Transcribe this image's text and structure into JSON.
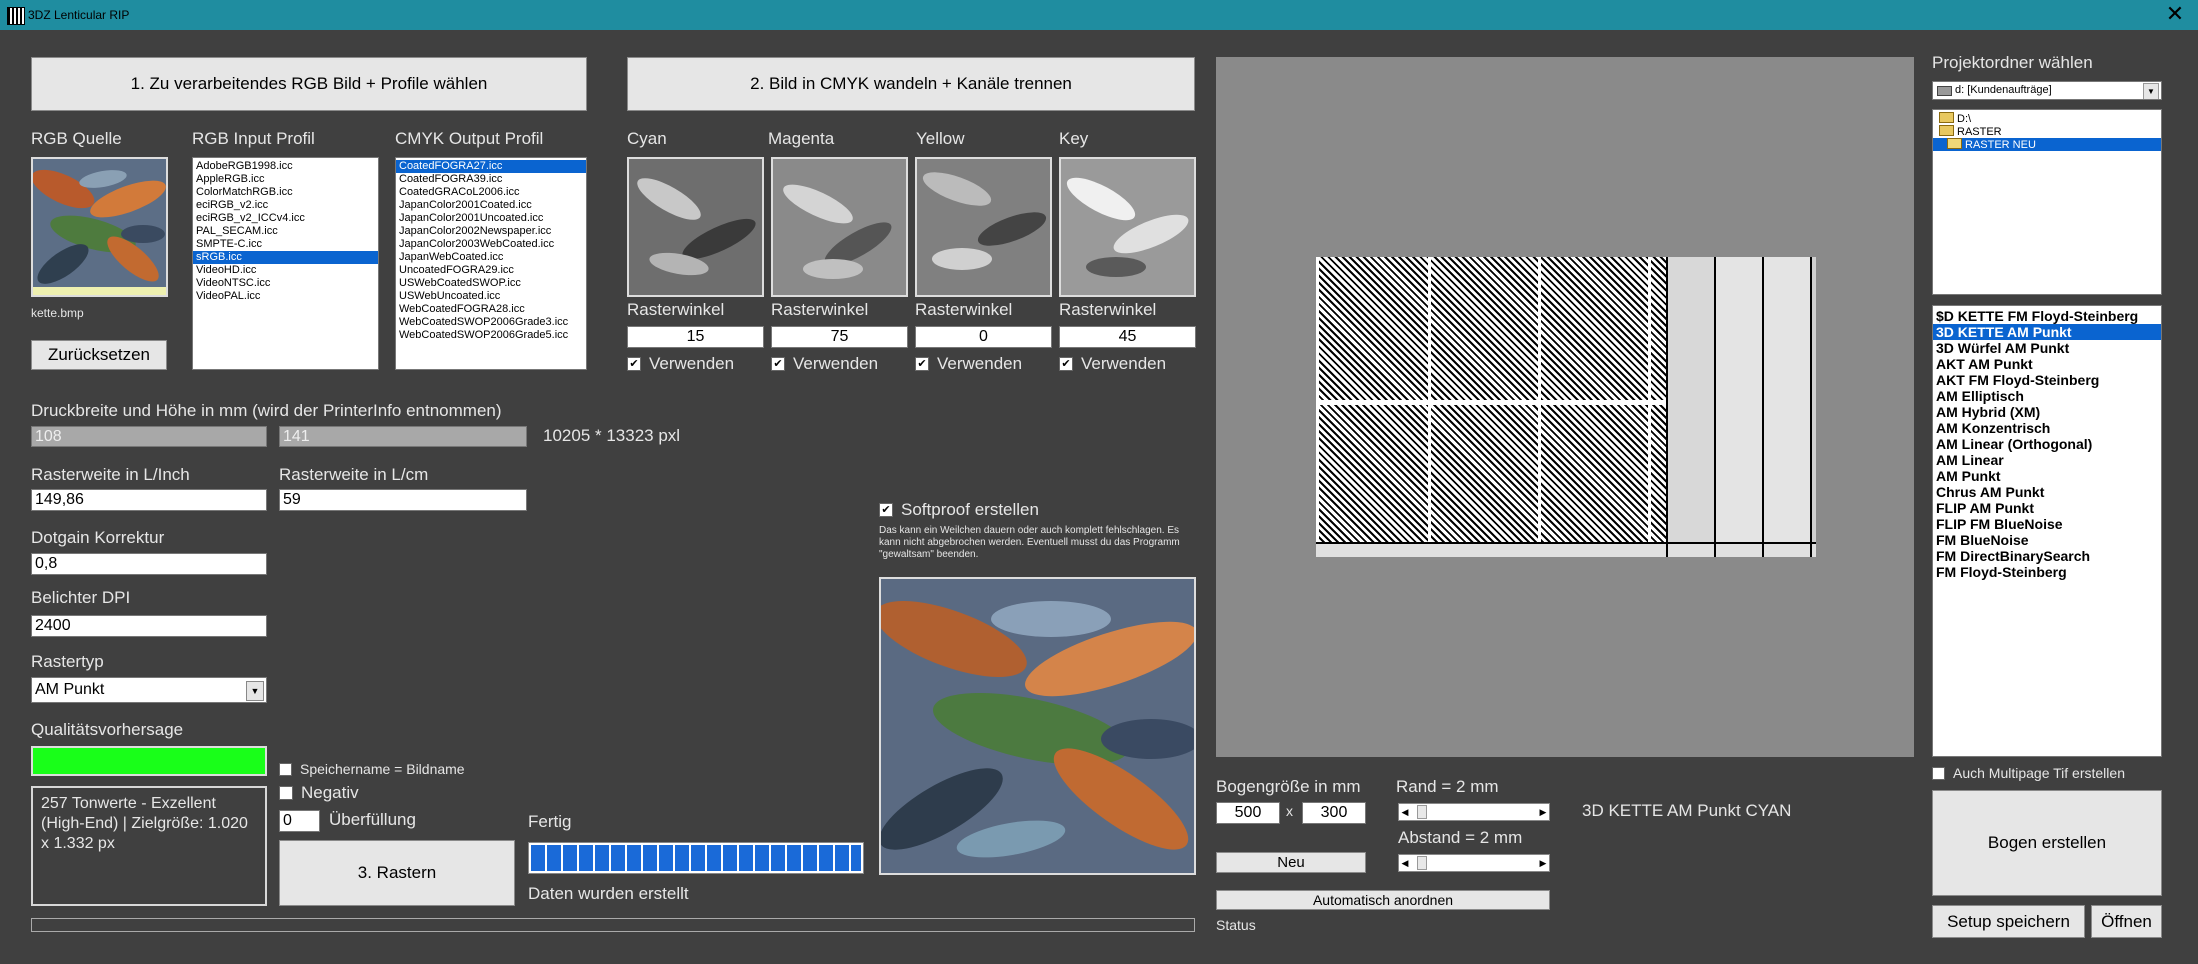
{
  "window": {
    "title": "3DZ Lenticular RIP",
    "close": "✕"
  },
  "step1": {
    "button": "1. Zu verarbeitendes RGB Bild + Profile wählen",
    "rgb_source_label": "RGB Quelle",
    "rgb_input_profile_label": "RGB Input Profil",
    "cmyk_output_profile_label": "CMYK Output Profil",
    "filename": "kette.bmp",
    "reset_button": "Zurücksetzen",
    "rgb_profiles": [
      "AdobeRGB1998.icc",
      "AppleRGB.icc",
      "ColorMatchRGB.icc",
      "eciRGB_v2.icc",
      "eciRGB_v2_ICCv4.icc",
      "PAL_SECAM.icc",
      "SMPTE-C.icc",
      "sRGB.icc",
      "VideoHD.icc",
      "VideoNTSC.icc",
      "VideoPAL.icc"
    ],
    "rgb_selected": "sRGB.icc",
    "cmyk_profiles": [
      "CoatedFOGRA27.icc",
      "CoatedFOGRA39.icc",
      "CoatedGRACoL2006.icc",
      "JapanColor2001Coated.icc",
      "JapanColor2001Uncoated.icc",
      "JapanColor2002Newspaper.icc",
      "JapanColor2003WebCoated.icc",
      "JapanWebCoated.icc",
      "UncoatedFOGRA29.icc",
      "USWebCoatedSWOP.icc",
      "USWebUncoated.icc",
      "WebCoatedFOGRA28.icc",
      "WebCoatedSWOP2006Grade3.icc",
      "WebCoatedSWOP2006Grade5.icc"
    ],
    "cmyk_selected": "CoatedFOGRA27.icc"
  },
  "step2": {
    "button": "2. Bild in CMYK wandeln + Kanäle trennen",
    "channels": [
      {
        "name": "Cyan",
        "angle_label": "Rasterwinkel",
        "angle": "15",
        "use_label": "Verwenden",
        "use": true
      },
      {
        "name": "Magenta",
        "angle_label": "Rasterwinkel",
        "angle": "75",
        "use_label": "Verwenden",
        "use": true
      },
      {
        "name": "Yellow",
        "angle_label": "Rasterwinkel",
        "angle": "0",
        "use_label": "Verwenden",
        "use": true
      },
      {
        "name": "Key",
        "angle_label": "Rasterwinkel",
        "angle": "45",
        "use_label": "Verwenden",
        "use": true
      }
    ]
  },
  "settings": {
    "print_size_label": "Druckbreite und Höhe in mm (wird der PrinterInfo entnommen)",
    "print_width": "108",
    "print_height": "141",
    "pixel_size": "10205 * 13323 pxl",
    "lpi_label": "Rasterweite in L/Inch",
    "lpi": "149,86",
    "lcm_label": "Rasterweite in L/cm",
    "lcm": "59",
    "dotgain_label": "Dotgain Korrektur",
    "dotgain": "0,8",
    "dpi_label": "Belichter DPI",
    "dpi": "2400",
    "rastertype_label": "Rastertyp",
    "rastertype": "AM Punkt",
    "quality_label": "Qualitätsvorhersage",
    "quality_text": "257 Tonwerte - Exzellent (High-End) | Zielgröße: 1.020 x 1.332 px",
    "savename_label": "Speichername = Bildname",
    "negative_label": "Negativ",
    "overfill_value": "0",
    "overfill_label": "Überfüllung",
    "raster_button": "3. Rastern",
    "done_label": "Fertig",
    "progress": 1.0,
    "status_text": "Daten wurden erstellt"
  },
  "softproof": {
    "label": "Softproof erstellen",
    "checked": true,
    "note": "Das kann ein Weilchen dauern oder auch komplett fehlschlagen. Es kann nicht abgebrochen werden. Eventuell musst du das Programm \"gewaltsam\" beenden."
  },
  "sheet": {
    "size_label": "Bogengröße in mm",
    "width": "500",
    "x": "x",
    "height": "300",
    "new_button": "Neu",
    "margin_label": "Rand = 2 mm",
    "spacing_label": "Abstand = 2 mm",
    "current_layer": "3D KETTE AM Punkt CYAN",
    "auto_button": "Automatisch anordnen",
    "status_label": "Status"
  },
  "project": {
    "label": "Projektordner wählen",
    "drive": "d: [Kundenaufträge]",
    "folders": [
      "D:\\",
      "RASTER",
      "RASTER NEU"
    ],
    "folder_selected": "RASTER NEU",
    "files": [
      "$D KETTE FM Floyd-Steinberg",
      "3D KETTE AM Punkt",
      "3D Würfel AM Punkt",
      "AKT AM Punkt",
      "AKT FM Floyd-Steinberg",
      "AM Elliptisch",
      "AM Hybrid (XM)",
      "AM Konzentrisch",
      "AM Linear (Orthogonal)",
      "AM Linear",
      "AM Punkt",
      "Chrus AM Punkt",
      "FLIP AM Punkt",
      "FLIP FM BlueNoise",
      "FM BlueNoise",
      "FM DirectBinarySearch",
      "FM Floyd-Steinberg"
    ],
    "file_selected": "3D KETTE AM Punkt",
    "multipage_label": "Auch Multipage Tif erstellen",
    "create_button": "Bogen erstellen",
    "save_button": "Setup speichern",
    "open_button": "Öffnen"
  },
  "colors": {
    "accent": "#0a64d0",
    "quality": "#19ff19",
    "background": "#404040",
    "titlebar": "#1f8da0"
  }
}
